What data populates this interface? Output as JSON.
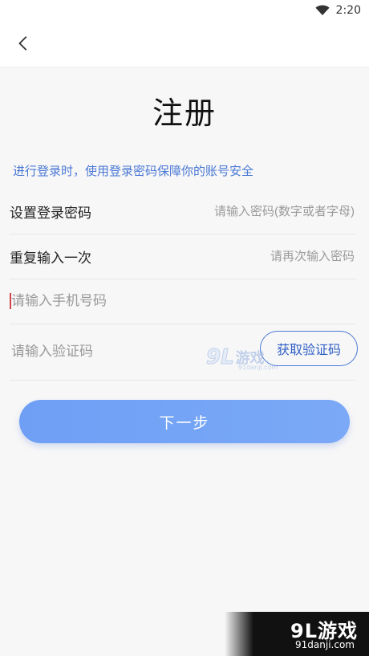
{
  "status": {
    "time": "2:20"
  },
  "page": {
    "title": "注册",
    "hint": "进行登录时，使用登录密码保障你的账号安全"
  },
  "form": {
    "password": {
      "label": "设置登录密码",
      "placeholder": "请输入密码(数字或者字母)"
    },
    "repeat": {
      "label": "重复输入一次",
      "placeholder": "请再次输入密码"
    },
    "phone": {
      "placeholder": "请输入手机号码"
    },
    "code": {
      "placeholder": "请输入验证码",
      "button_label": "获取验证码"
    }
  },
  "actions": {
    "next_label": "下一步"
  },
  "watermark": {
    "mid_number": "9L",
    "mid_text": "游戏",
    "mid_url": "91danji.com",
    "corner_brand": "9L游戏",
    "corner_site": "91danji.com"
  },
  "icons": {
    "back": "chevron-left-icon",
    "wifi": "wifi-icon"
  },
  "colors": {
    "accent": "#4a78d6",
    "button": "#6e9ff5"
  }
}
